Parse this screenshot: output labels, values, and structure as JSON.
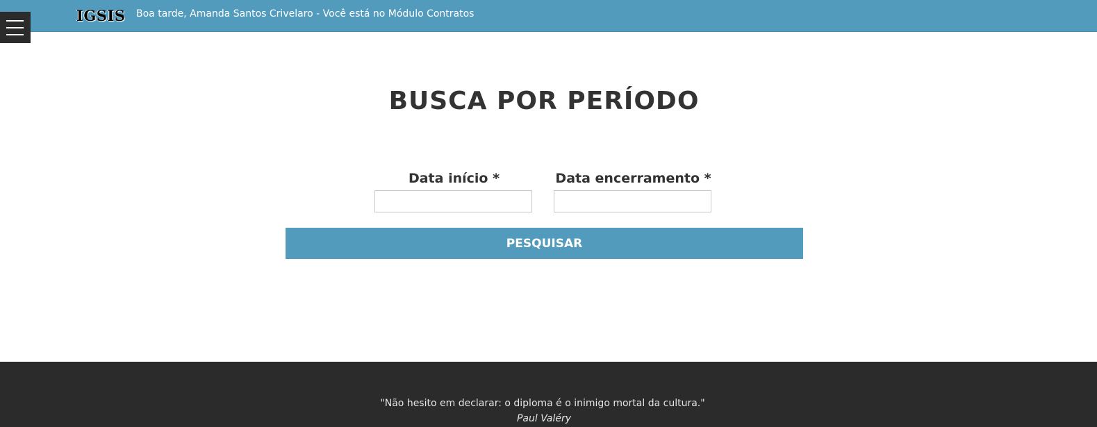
{
  "colors": {
    "header_bg": "#529bbc",
    "button_bg": "#529bbc",
    "footer_bg": "#2b2b2b",
    "menu_bg": "#2b2b2b",
    "title_text": "#333333"
  },
  "header": {
    "brand": "IGSIS",
    "greeting": "Boa tarde, Amanda Santos Crivelaro - Você está no Módulo Contratos",
    "menu_icon": "hamburger-menu-icon"
  },
  "main": {
    "title": "BUSCA POR PERÍODO",
    "fields": {
      "start": {
        "label": "Data início *",
        "value": "",
        "placeholder": ""
      },
      "end": {
        "label": "Data encerramento *",
        "value": "",
        "placeholder": ""
      }
    },
    "submit_label": "PESQUISAR"
  },
  "footer": {
    "quote": "\"Não hesito em declarar: o diploma é o inimigo mortal da cultura.\"",
    "author": "Paul Valéry"
  }
}
